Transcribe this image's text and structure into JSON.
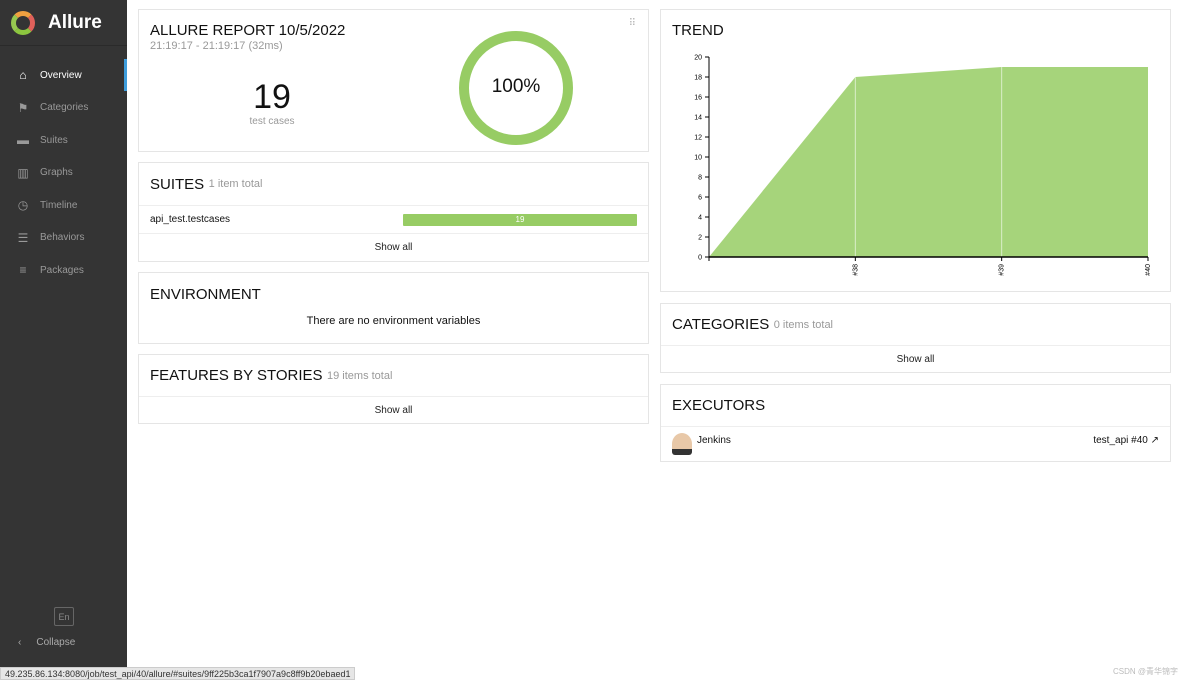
{
  "app": {
    "name": "Allure"
  },
  "sidebar": {
    "items": [
      {
        "label": "Overview",
        "icon": "home-icon",
        "active": true
      },
      {
        "label": "Categories",
        "icon": "flag-icon"
      },
      {
        "label": "Suites",
        "icon": "briefcase-icon"
      },
      {
        "label": "Graphs",
        "icon": "bar-chart-icon"
      },
      {
        "label": "Timeline",
        "icon": "clock-icon"
      },
      {
        "label": "Behaviors",
        "icon": "list-icon"
      },
      {
        "label": "Packages",
        "icon": "align-left-icon"
      }
    ],
    "lang": "En",
    "collapse": "Collapse"
  },
  "report": {
    "title": "ALLURE REPORT 10/5/2022",
    "time": "21:19:17 - 21:19:17 (32ms)",
    "count": "19",
    "count_label": "test cases",
    "percent": "100%",
    "pass_fraction": 1.0,
    "color": "#97cc64"
  },
  "suites": {
    "title": "SUITES",
    "subtitle": "1 item total",
    "items": [
      {
        "name": "api_test.testcases",
        "passed": "19"
      }
    ],
    "show_all": "Show all"
  },
  "environment": {
    "title": "ENVIRONMENT",
    "empty": "There are no environment variables"
  },
  "features": {
    "title": "FEATURES BY STORIES",
    "subtitle": "19 items total",
    "show_all": "Show all"
  },
  "trend": {
    "title": "TREND"
  },
  "chart_data": {
    "type": "area",
    "categories": [
      "",
      "#38",
      "#39",
      "#40"
    ],
    "values": [
      0,
      18,
      19,
      19
    ],
    "ylim": [
      0,
      20
    ],
    "yticks": [
      0,
      2,
      4,
      6,
      8,
      10,
      12,
      14,
      16,
      18,
      20
    ],
    "color": "#97cc64",
    "grid": false
  },
  "categories": {
    "title": "CATEGORIES",
    "subtitle": "0 items total",
    "show_all": "Show all"
  },
  "executors": {
    "title": "EXECUTORS",
    "name": "Jenkins",
    "build": "test_api #40"
  },
  "statusbar": {
    "url": "49.235.86.134:8080/job/test_api/40/allure/#suites/9ff225b3ca1f7907a9c8ff9b20ebaed1"
  },
  "watermark": "CSDN @青华锦字"
}
